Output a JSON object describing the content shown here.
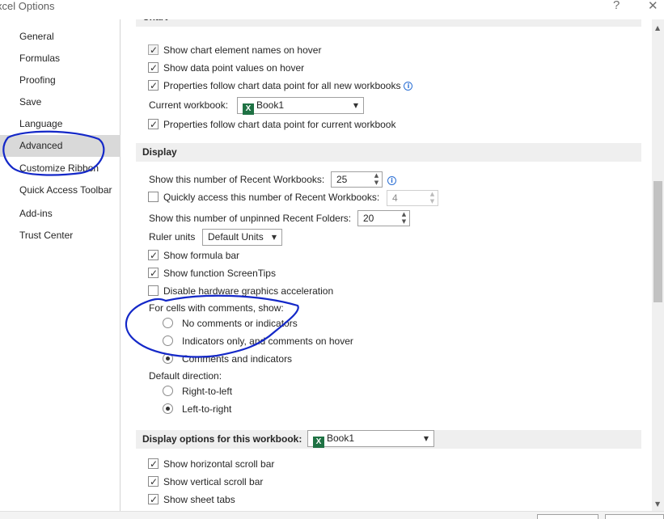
{
  "window": {
    "title": "xcel Options",
    "help_icon": "?",
    "close_icon": "✕"
  },
  "nav": {
    "items": [
      {
        "label": "General"
      },
      {
        "label": "Formulas"
      },
      {
        "label": "Proofing"
      },
      {
        "label": "Save"
      },
      {
        "label": "Language"
      },
      {
        "label": "Advanced",
        "selected": true
      },
      {
        "label": "Customize Ribbon"
      },
      {
        "label": "Quick Access Toolbar"
      },
      {
        "label": "Add-ins"
      },
      {
        "label": "Trust Center"
      }
    ]
  },
  "chart": {
    "header": "Chart",
    "show_element_names": {
      "label": "Show chart element names on hover",
      "checked": true
    },
    "show_data_point_values": {
      "label": "Show data point values on hover",
      "checked": true
    },
    "properties_follow_all": {
      "label": "Properties follow chart data point for all new workbooks",
      "checked": true
    },
    "current_workbook_label": "Current workbook:",
    "current_workbook_value": "Book1",
    "properties_follow_current": {
      "label": "Properties follow chart data point for current workbook",
      "checked": true
    }
  },
  "display": {
    "header": "Display",
    "recent_workbooks_label": "Show this number of Recent Workbooks:",
    "recent_workbooks_value": "25",
    "quick_access_label": "Quickly access this number of Recent Workbooks:",
    "quick_access_value": "4",
    "unpinned_folders_label": "Show this number of unpinned Recent Folders:",
    "unpinned_folders_value": "20",
    "ruler_units_label": "Ruler units",
    "ruler_units_value": "Default Units",
    "show_formula_bar": "Show formula bar",
    "show_function_screentips": "Show function ScreenTips",
    "disable_hw_accel": "Disable hardware graphics acceleration",
    "comments_label": "For cells with comments, show:",
    "comments_options": [
      {
        "label": "No comments or indicators",
        "selected": false
      },
      {
        "label": "Indicators only, and comments on hover",
        "selected": false
      },
      {
        "label": "Comments and indicators",
        "selected": true
      }
    ],
    "direction_label": "Default direction:",
    "direction_options": [
      {
        "label": "Right-to-left",
        "selected": false
      },
      {
        "label": "Left-to-right",
        "selected": true
      }
    ]
  },
  "workbook_display": {
    "header": "Display options for this workbook:",
    "workbook_value": "Book1",
    "show_horizontal_scroll": "Show horizontal scroll bar",
    "show_vertical_scroll": "Show vertical scroll bar",
    "show_sheet_tabs": "Show sheet tabs"
  },
  "icons": {
    "excel": "excel-workbook-icon",
    "info": "info-icon",
    "dropdown": "chevron-down-icon"
  },
  "colors": {
    "annotation": "#1428c8",
    "excel_green": "#1f7244",
    "selected_nav": "#d9d9d9"
  }
}
